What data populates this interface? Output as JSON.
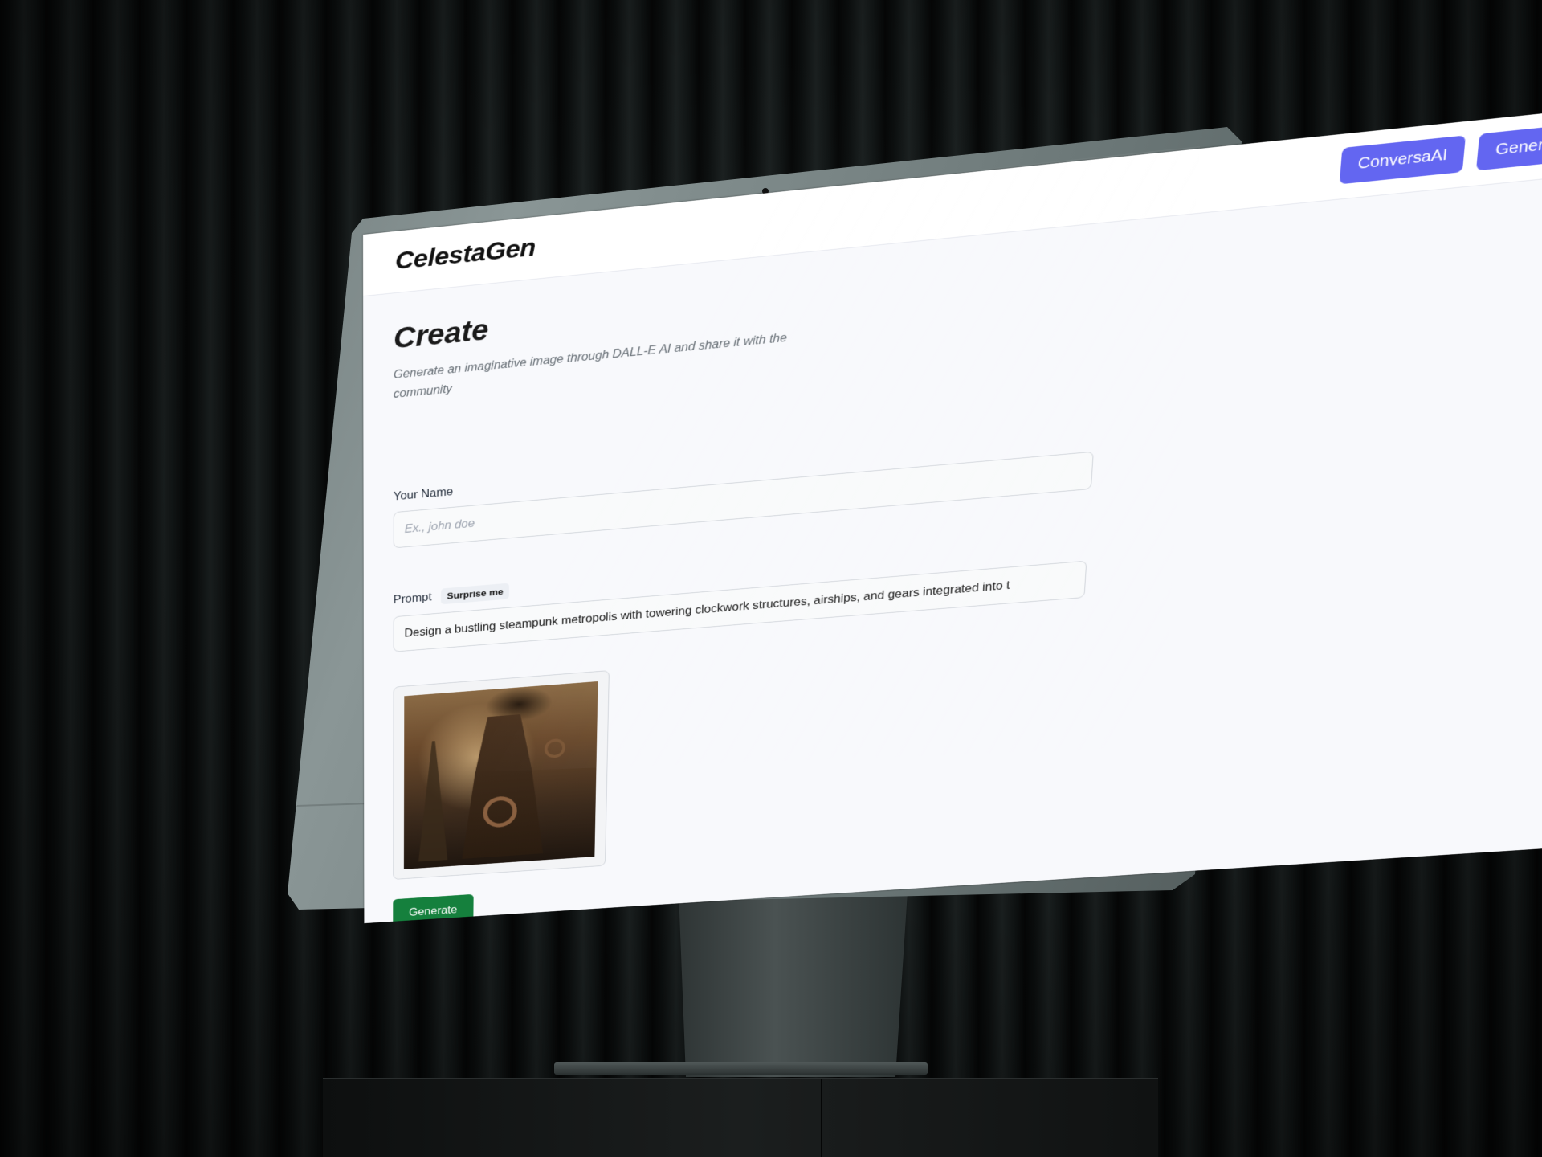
{
  "app": {
    "logo": "CelestaGen"
  },
  "nav": {
    "items": [
      {
        "label": "ConversaAI"
      },
      {
        "label": "Generate Images"
      }
    ]
  },
  "page": {
    "title": "Create",
    "subtitle": "Generate an imaginative image through DALL-E AI and share it with the community"
  },
  "form": {
    "name": {
      "label": "Your Name",
      "placeholder": "Ex., john doe",
      "value": ""
    },
    "prompt": {
      "label": "Prompt",
      "surprise_label": "Surprise me",
      "value": "Design a bustling steampunk metropolis with towering clockwork structures, airships, and gears integrated into t"
    },
    "generate_label": "Generate"
  },
  "colors": {
    "accent": "#6366f1",
    "generate": "#15803d"
  }
}
